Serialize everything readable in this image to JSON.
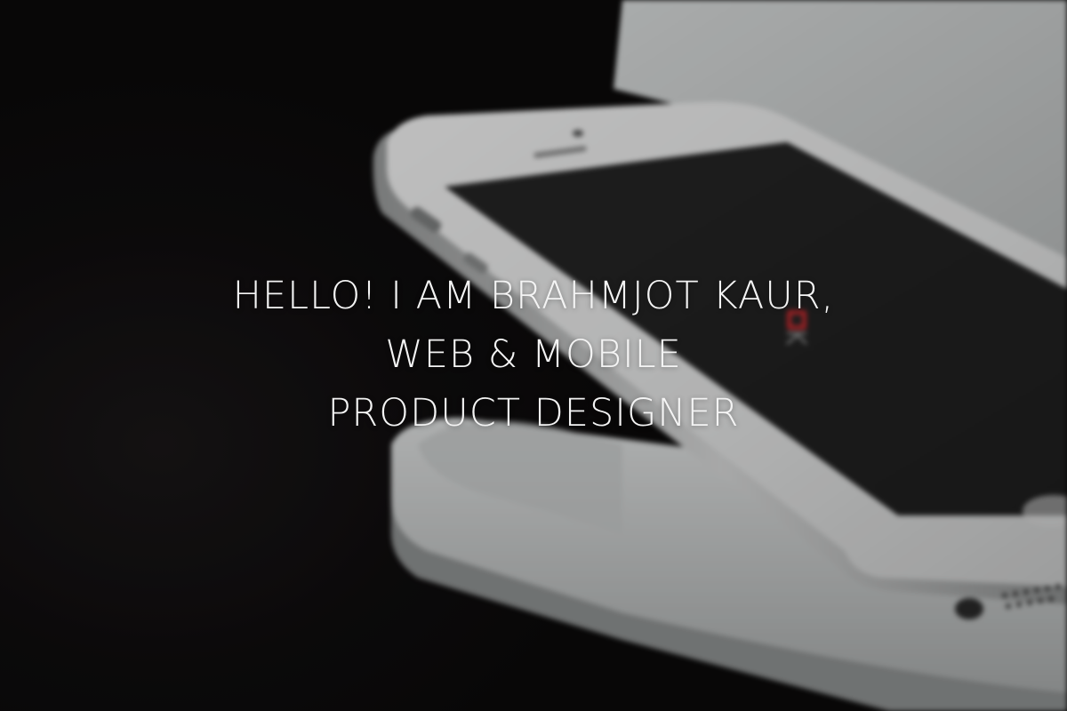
{
  "hero": {
    "lines": [
      "HELLO! I AM BRAHMJOT KAUR,",
      "WEB & MOBILE",
      "PRODUCT DESIGNER"
    ],
    "text_color": "#f4f4f4"
  },
  "photo": {
    "logo_icon": "bk-logo-icon",
    "phone_icon": "smartphone-icon",
    "laptop_icon": "laptop-icon",
    "logo_color": "#c62a2f"
  }
}
